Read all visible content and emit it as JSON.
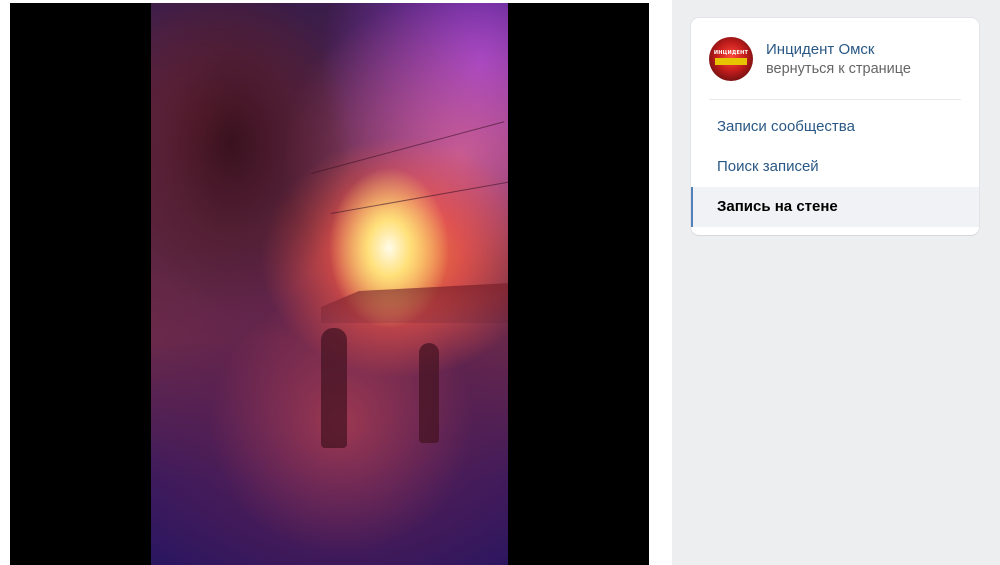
{
  "video": {
    "description_icon": "video-frame"
  },
  "sidebar": {
    "group": {
      "name": "Инцидент Омск",
      "back_label": "вернуться к странице",
      "avatar_text": "ИНЦИДЕНТ"
    },
    "nav": [
      {
        "label": "Записи сообщества",
        "active": false
      },
      {
        "label": "Поиск записей",
        "active": false
      },
      {
        "label": "Запись на стене",
        "active": true
      }
    ]
  },
  "colors": {
    "link": "#2a5885",
    "active_marker": "#5181b8",
    "panel_bg": "#edeef0"
  }
}
